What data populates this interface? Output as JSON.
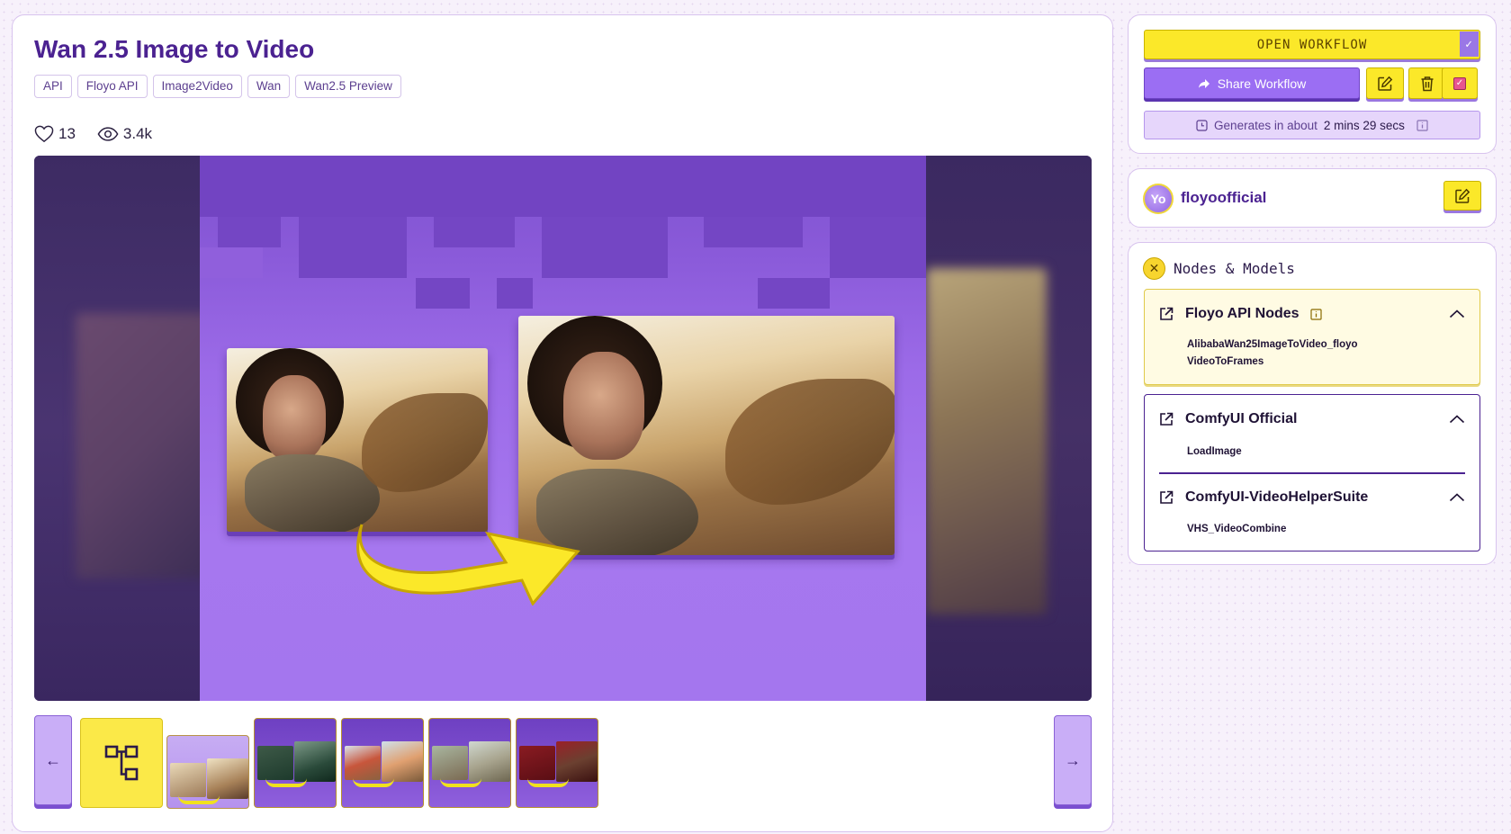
{
  "page": {
    "title": "Wan 2.5 Image to Video",
    "tags": [
      "API",
      "Floyo API",
      "Image2Video",
      "Wan",
      "Wan2.5 Preview"
    ],
    "likes": "13",
    "views": "3.4k"
  },
  "gallery": {
    "prev_label": "←",
    "next_label": "→",
    "thumbnail_count": 6,
    "active_index": 1
  },
  "actions": {
    "open_workflow_label": "OPEN WORKFLOW",
    "share_workflow_label": "Share Workflow",
    "generates_prefix": "Generates in about",
    "generates_time": "2 mins 29 secs"
  },
  "author": {
    "avatar_initials": "Yo",
    "name": "floyoofficial"
  },
  "nodes": {
    "heading": "Nodes & Models",
    "groups": [
      {
        "name": "Floyo API Nodes",
        "items": [
          "AlibabaWan25ImageToVideo_floyo",
          "VideoToFrames"
        ]
      },
      {
        "name": "ComfyUI Official",
        "items": [
          "LoadImage"
        ]
      },
      {
        "name": "ComfyUI-VideoHelperSuite",
        "items": [
          "VHS_VideoCombine"
        ]
      }
    ]
  },
  "colors": {
    "accent_purple": "#4b2291",
    "brand_yellow": "#fbe829",
    "button_purple": "#9b6ef3"
  }
}
